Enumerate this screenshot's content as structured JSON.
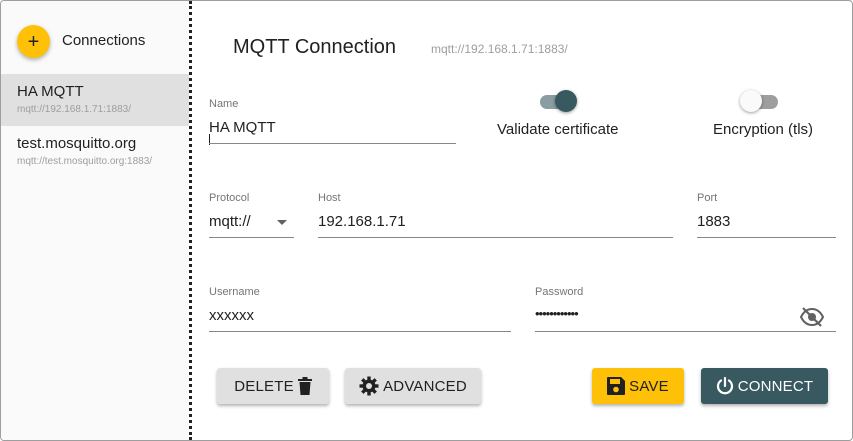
{
  "sidebar": {
    "add_icon": "+",
    "title": "Connections",
    "connections": [
      {
        "name": "HA MQTT",
        "url": "mqtt://192.168.1.71:1883/",
        "active": true
      },
      {
        "name": "test.mosquitto.org",
        "url": "mqtt://test.mosquitto.org:1883/",
        "active": false
      }
    ]
  },
  "main": {
    "title": "MQTT Connection",
    "url": "mqtt://192.168.1.71:1883/",
    "name": {
      "label": "Name",
      "value": "HA MQTT"
    },
    "validate_certificate": {
      "label": "Validate certificate",
      "on": true
    },
    "encryption": {
      "label": "Encryption (tls)",
      "on": false
    },
    "protocol": {
      "label": "Protocol",
      "value": "mqtt://"
    },
    "host": {
      "label": "Host",
      "value": "192.168.1.71"
    },
    "port": {
      "label": "Port",
      "value": "1883"
    },
    "username": {
      "label": "Username",
      "value": "xxxxxx"
    },
    "password": {
      "label": "Password",
      "value": "••••••••••••"
    }
  },
  "buttons": {
    "delete": "DELETE",
    "advanced": "ADVANCED",
    "save": "SAVE",
    "connect": "CONNECT"
  },
  "colors": {
    "accent": "#ffc107",
    "primary": "#37595f",
    "toggle_on_knob": "#37595f",
    "toggle_on_track": "#8a9ea1",
    "toggle_off_knob": "#fafafa",
    "toggle_off_track": "#9e9e9e"
  },
  "icons": {
    "add": "plus-icon",
    "protocol_dropdown": "caret-down-icon",
    "password_visibility": "eye-off-icon",
    "delete": "trash-icon",
    "advanced": "gear-icon",
    "save": "floppy-disk-icon",
    "connect": "power-icon"
  }
}
